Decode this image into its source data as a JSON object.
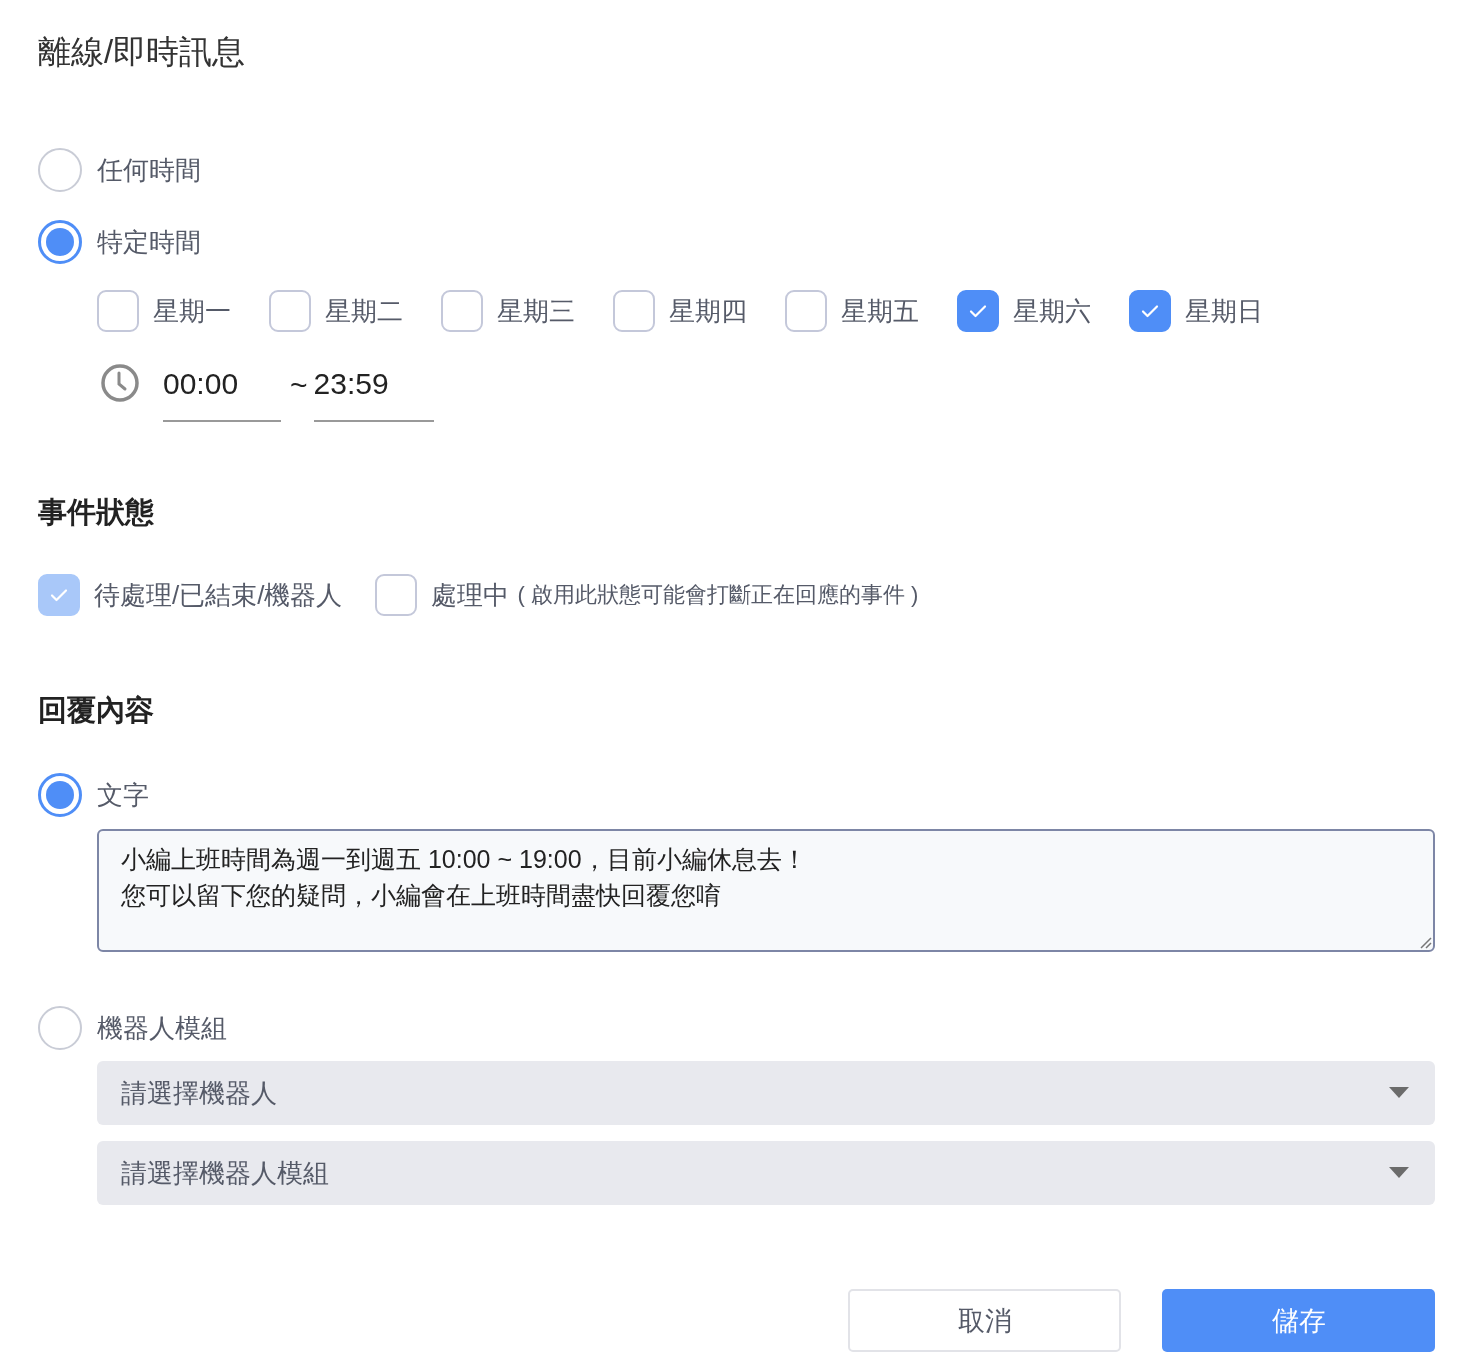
{
  "title": "離線/即時訊息",
  "schedule": {
    "options": [
      {
        "label": "任何時間",
        "selected": false
      },
      {
        "label": "特定時間",
        "selected": true
      }
    ],
    "days": [
      {
        "label": "星期一",
        "checked": false
      },
      {
        "label": "星期二",
        "checked": false
      },
      {
        "label": "星期三",
        "checked": false
      },
      {
        "label": "星期四",
        "checked": false
      },
      {
        "label": "星期五",
        "checked": false
      },
      {
        "label": "星期六",
        "checked": true
      },
      {
        "label": "星期日",
        "checked": true
      }
    ],
    "time": {
      "start": "00:00",
      "separator": "~",
      "end": "23:59"
    }
  },
  "event_status": {
    "heading": "事件狀態",
    "options": [
      {
        "label": "待處理/已結束/機器人",
        "checked": true,
        "disabled": true
      },
      {
        "label": "處理中",
        "note": "( 啟用此狀態可能會打斷正在回應的事件 )",
        "checked": false,
        "disabled": false
      }
    ]
  },
  "reply": {
    "heading": "回覆內容",
    "options": [
      {
        "kind": "text",
        "label": "文字",
        "selected": true,
        "message_lines": [
          "小編上班時間為週一到週五 10:00 ~ 19:00，目前小編休息去！",
          "您可以留下您的疑問，小編會在上班時間盡快回覆您唷"
        ]
      },
      {
        "kind": "robot",
        "label": "機器人模組",
        "selected": false,
        "selects": [
          {
            "placeholder": "請選擇機器人"
          },
          {
            "placeholder": "請選擇機器人模組"
          }
        ]
      }
    ]
  },
  "buttons": [
    {
      "label": "取消",
      "kind": "secondary"
    },
    {
      "label": "儲存",
      "kind": "primary"
    }
  ]
}
